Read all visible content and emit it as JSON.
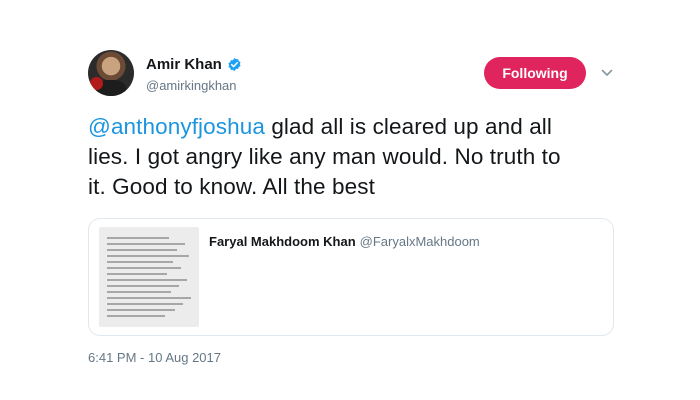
{
  "author": {
    "name": "Amir Khan",
    "handle": "@amirkingkhan",
    "verified": true,
    "avatar_icon": "profile-photo"
  },
  "follow_button": {
    "label": "Following",
    "color": "#e0245e"
  },
  "menu_icon": "chevron-down-icon",
  "tweet": {
    "mention": "@anthonyfjoshua",
    "text": " glad all is cleared up and all lies. I got angry like any man would. No truth to it. Good to know. All the best"
  },
  "quoted_tweet": {
    "author_name": "Faryal Makhdoom Khan",
    "author_handle": "@FaryalxMakhdoom",
    "image_icon": "screenshot-thumbnail"
  },
  "timestamp": "6:41 PM - 10 Aug 2017",
  "colors": {
    "link": "#1b95e0",
    "secondary_text": "#657786",
    "border": "#e1e8ed"
  }
}
